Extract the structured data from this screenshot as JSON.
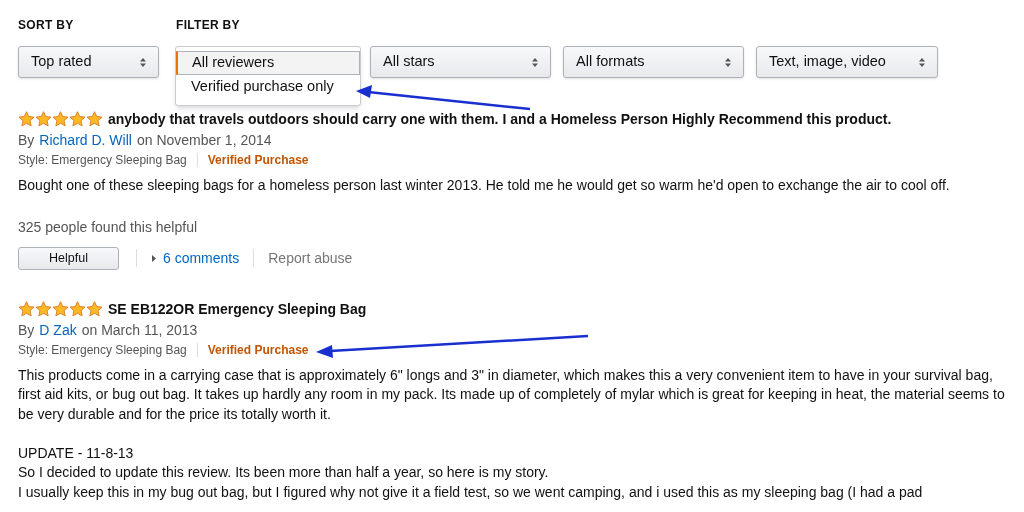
{
  "sort": {
    "label": "SORT BY",
    "value": "Top rated"
  },
  "filter": {
    "label": "FILTER BY",
    "dropdown": {
      "expanded": true,
      "options": [
        {
          "label": "All reviewers",
          "selected": true
        },
        {
          "label": "Verified purchase only",
          "selected": false
        }
      ]
    },
    "selects": [
      "All stars",
      "All formats",
      "Text, image, video"
    ]
  },
  "reviews": [
    {
      "stars": 5,
      "title": "anybody that travels outdoors should carry one with them. I and a Homeless Person Highly Recommend this product.",
      "by": "By",
      "author": "Richard D. Will",
      "date": "on November 1, 2014",
      "style": "Style: Emergency Sleeping Bag",
      "badge": "Verified Purchase",
      "body": [
        [
          "Bought one of these sleeping bags for a homeless person last winter 2013. He told me he would get so warm he'd open to exchange the air to cool off."
        ]
      ],
      "helpful_count": "325 people found this helpful",
      "helpful_button": "Helpful",
      "comments": "6 comments",
      "report": "Report abuse"
    },
    {
      "stars": 5,
      "title": "SE EB122OR Emergency Sleeping Bag",
      "by": "By",
      "author": "D Zak",
      "date": "on March 11, 2013",
      "style": "Style: Emergency Sleeping Bag",
      "badge": "Verified Purchase",
      "body": [
        [
          "This products come in a carrying case that is approximately 6\" longs and 3\" in diameter, which makes this a very convenient item to have in your survival bag, first aid kits, or bug out bag. It takes up hardly any room in my pack. Its made up of completely of mylar which is great for keeping in heat, the material seems to be very durable and for the price its totally worth it."
        ],
        [
          "UPDATE - 11-8-13",
          "So I decided to update this review. Its been more than half a year, so here is my story.",
          "I usually keep this in my bug out bag, but I figured why not give it a field test, so we went camping, and i used this as my sleeping bag (I had a pad"
        ]
      ]
    }
  ]
}
